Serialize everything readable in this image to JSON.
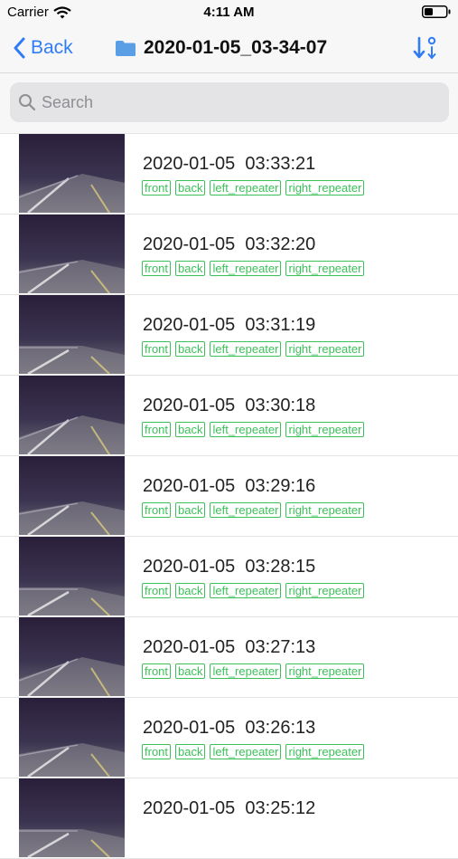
{
  "status_bar": {
    "carrier": "Carrier",
    "time": "4:11 AM"
  },
  "nav": {
    "back_label": "Back",
    "title": "2020-01-05_03-34-07"
  },
  "search": {
    "placeholder": "Search"
  },
  "clips": [
    {
      "title": "2020-01-05  03:33:21",
      "tags": [
        "front",
        "back",
        "left_repeater",
        "right_repeater"
      ]
    },
    {
      "title": "2020-01-05  03:32:20",
      "tags": [
        "front",
        "back",
        "left_repeater",
        "right_repeater"
      ]
    },
    {
      "title": "2020-01-05  03:31:19",
      "tags": [
        "front",
        "back",
        "left_repeater",
        "right_repeater"
      ]
    },
    {
      "title": "2020-01-05  03:30:18",
      "tags": [
        "front",
        "back",
        "left_repeater",
        "right_repeater"
      ]
    },
    {
      "title": "2020-01-05  03:29:16",
      "tags": [
        "front",
        "back",
        "left_repeater",
        "right_repeater"
      ]
    },
    {
      "title": "2020-01-05  03:28:15",
      "tags": [
        "front",
        "back",
        "left_repeater",
        "right_repeater"
      ]
    },
    {
      "title": "2020-01-05  03:27:13",
      "tags": [
        "front",
        "back",
        "left_repeater",
        "right_repeater"
      ]
    },
    {
      "title": "2020-01-05  03:26:13",
      "tags": [
        "front",
        "back",
        "left_repeater",
        "right_repeater"
      ]
    },
    {
      "title": "2020-01-05  03:25:12",
      "tags": []
    }
  ],
  "icons": {
    "back": "chevron-left-icon",
    "folder": "folder-icon",
    "sort": "sort-icon",
    "search": "search-icon",
    "wifi": "wifi-icon",
    "battery": "battery-icon"
  },
  "colors": {
    "accent": "#2f7cf6",
    "tag": "#3cc15a",
    "folder": "#5a9ee6"
  }
}
